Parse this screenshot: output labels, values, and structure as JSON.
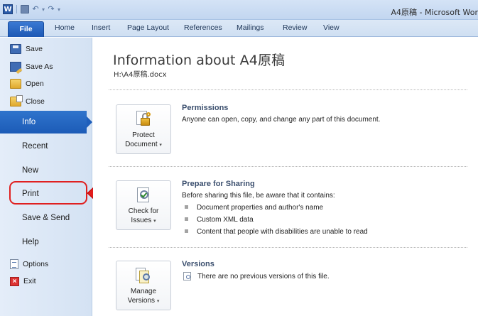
{
  "window": {
    "title": "A4原稿 - Microsoft Wor",
    "app_icon_letter": "W"
  },
  "quick_access": {
    "icons": [
      "save-icon",
      "undo-icon",
      "redo-icon",
      "customize-dropdown-icon"
    ]
  },
  "ribbon_tabs": [
    "File",
    "Home",
    "Insert",
    "Page Layout",
    "References",
    "Mailings",
    "Review",
    "View"
  ],
  "backstage_commands": [
    {
      "label": "Save",
      "icon": "save-icon"
    },
    {
      "label": "Save As",
      "icon": "save-as-icon"
    },
    {
      "label": "Open",
      "icon": "open-folder-icon"
    },
    {
      "label": "Close",
      "icon": "close-folder-icon"
    }
  ],
  "backstage_nav": [
    {
      "label": "Info",
      "selected": true
    },
    {
      "label": "Recent",
      "selected": false
    },
    {
      "label": "New",
      "selected": false
    },
    {
      "label": "Print",
      "selected": false,
      "highlighted": true
    },
    {
      "label": "Save & Send",
      "selected": false
    },
    {
      "label": "Help",
      "selected": false
    }
  ],
  "backstage_footer": [
    {
      "label": "Options",
      "icon": "options-icon"
    },
    {
      "label": "Exit",
      "icon": "exit-icon"
    }
  ],
  "info": {
    "title": "Information about A4原稿",
    "path": "H:\\A4原稿.docx",
    "permissions": {
      "button_line1": "Protect",
      "button_line2": "Document",
      "heading": "Permissions",
      "description": "Anyone can open, copy, and change any part of this document."
    },
    "prepare": {
      "button_line1": "Check for",
      "button_line2": "Issues",
      "heading": "Prepare for Sharing",
      "description": "Before sharing this file, be aware that it contains:",
      "items": [
        "Document properties and author's name",
        "Custom XML data",
        "Content that people with disabilities are unable to read"
      ]
    },
    "versions": {
      "button_line1": "Manage",
      "button_line2": "Versions",
      "heading": "Versions",
      "description": "There are no previous versions of this file."
    }
  },
  "colors": {
    "accent": "#1f5fbb",
    "highlight": "#e02020"
  }
}
